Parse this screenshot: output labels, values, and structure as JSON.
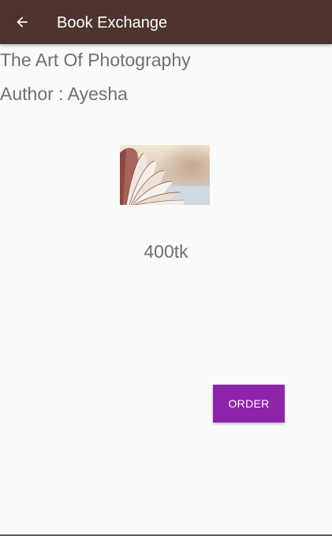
{
  "appbar": {
    "title": "Book Exchange",
    "back_icon": "arrow-left-icon",
    "background": "#4e342e"
  },
  "book": {
    "title": "The Art Of Photography",
    "author_line": "Author : Ayesha",
    "price": "400tk",
    "cover_image": "open-book-photo"
  },
  "actions": {
    "order_label": "ORDER",
    "order_color": "#8e24aa"
  }
}
